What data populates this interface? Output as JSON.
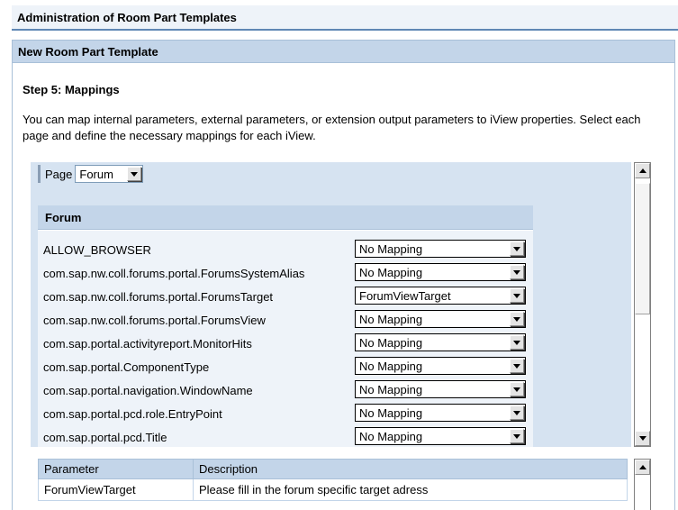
{
  "header": {
    "title": "Administration of Room Part Templates"
  },
  "panel": {
    "title": "New Room Part Template"
  },
  "step": {
    "title": "Step 5: Mappings",
    "description": "You can map internal parameters, external parameters, or extension output parameters to iView properties. Select each page and define the necessary mappings for each iView."
  },
  "page_selector": {
    "label": "Page",
    "value": "Forum"
  },
  "forum": {
    "title": "Forum",
    "rows": [
      {
        "param": "ALLOW_BROWSER",
        "mapping": "No Mapping"
      },
      {
        "param": "com.sap.nw.coll.forums.portal.ForumsSystemAlias",
        "mapping": "No Mapping"
      },
      {
        "param": "com.sap.nw.coll.forums.portal.ForumsTarget",
        "mapping": "ForumViewTarget"
      },
      {
        "param": "com.sap.nw.coll.forums.portal.ForumsView",
        "mapping": "No Mapping"
      },
      {
        "param": "com.sap.portal.activityreport.MonitorHits",
        "mapping": "No Mapping"
      },
      {
        "param": "com.sap.portal.ComponentType",
        "mapping": "No Mapping"
      },
      {
        "param": "com.sap.portal.navigation.WindowName",
        "mapping": "No Mapping"
      },
      {
        "param": "com.sap.portal.pcd.role.EntryPoint",
        "mapping": "No Mapping"
      },
      {
        "param": "com.sap.portal.pcd.Title",
        "mapping": "No Mapping"
      }
    ]
  },
  "param_table": {
    "headers": [
      "Parameter",
      "Description"
    ],
    "rows": [
      {
        "parameter": "ForumViewTarget",
        "description": "Please fill in the forum specific target adress"
      }
    ]
  }
}
